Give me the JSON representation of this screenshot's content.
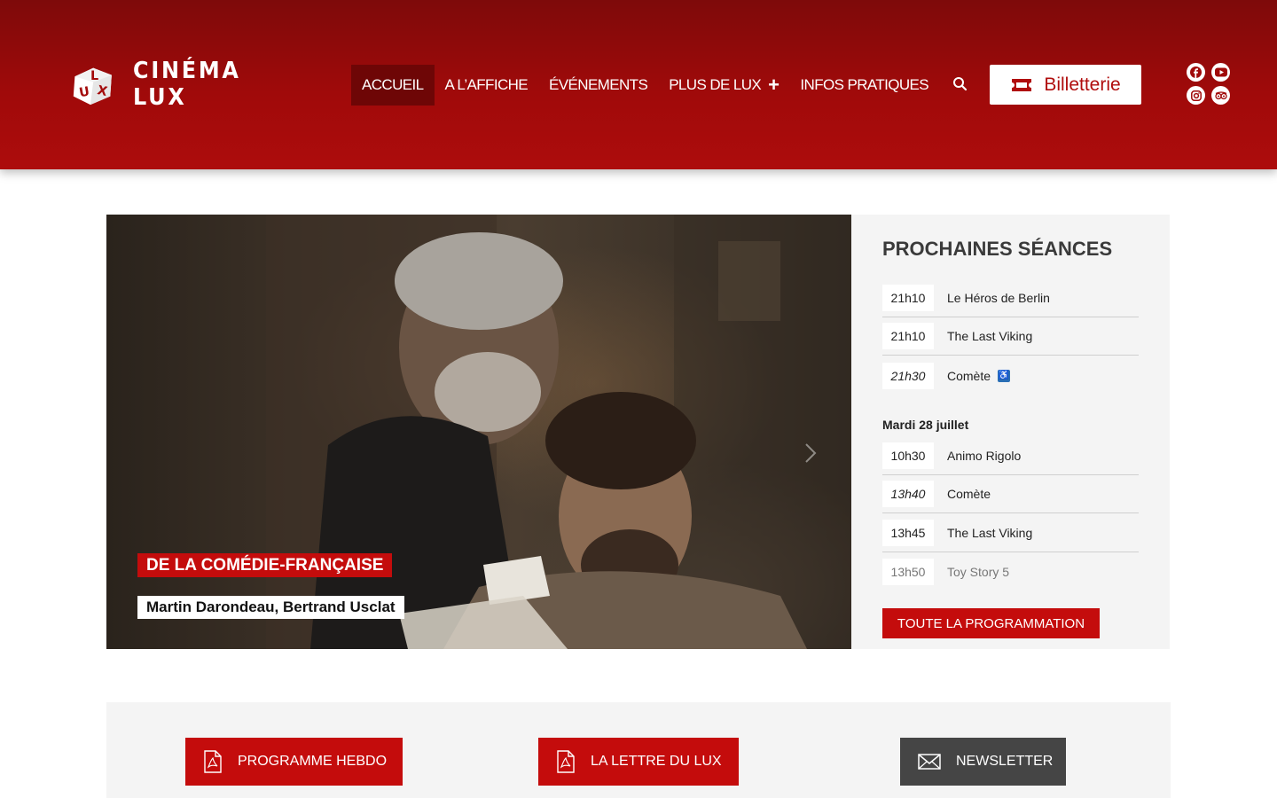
{
  "brand": {
    "name": "CINÉMA LUX",
    "logo_letters": "LUX",
    "logo_small": "Cinéma"
  },
  "nav": {
    "items": [
      {
        "label": "ACCUEIL"
      },
      {
        "label": "A L’AFFICHE"
      },
      {
        "label": "ÉVÉNEMENTS"
      },
      {
        "label": "PLUS DE LUX"
      },
      {
        "label": "INFOS PRATIQUES"
      }
    ],
    "plus_symbol": "+"
  },
  "ticket": {
    "label": "Billetterie"
  },
  "social": [
    "facebook-icon",
    "youtube-icon",
    "instagram-icon",
    "tripadvisor-icon"
  ],
  "hero": {
    "tag": "DE LA COMÉDIE-FRANÇAISE",
    "credit": "Martin Darondeau, Bertrand Usclat"
  },
  "sessions": {
    "title": "PROCHAINES SÉANCES",
    "today": [
      {
        "time": "21h10",
        "title": "Le Héros de Berlin"
      },
      {
        "time": "21h10",
        "title": "The Last Viking"
      },
      {
        "time": "21h30",
        "title": "Comète"
      }
    ],
    "day_label": "Mardi 28 juillet",
    "tomorrow": [
      {
        "time": "10h30",
        "title": "Animo Rigolo"
      },
      {
        "time": "13h40",
        "title": "Comète"
      },
      {
        "time": "13h45",
        "title": "The Last Viking"
      },
      {
        "time": "13h50",
        "title": "Toy Story 5"
      }
    ],
    "all_button": "TOUTE LA PROGRAMMATION"
  },
  "downloads": {
    "programme": "PROGRAMME HEBDO",
    "lettre": "LA LETTRE DU LUX",
    "newsletter": "NEWSLETTER"
  },
  "colors": {
    "brand_red": "#c40c0c",
    "header_dark": "#7e0a0a",
    "panel_bg": "#f4f4f4",
    "dark_button": "#454545"
  }
}
